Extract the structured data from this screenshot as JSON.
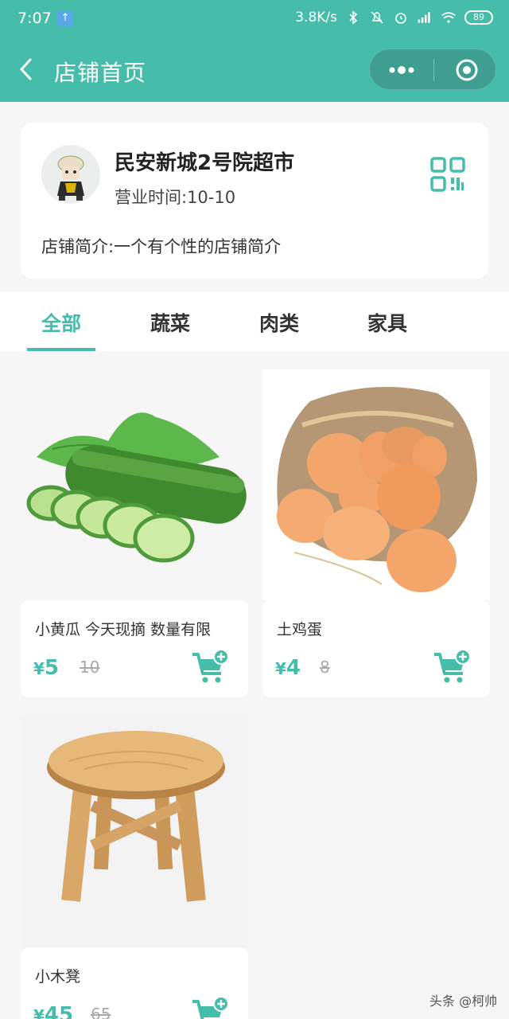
{
  "status_bar": {
    "time": "7:07",
    "speed": "3.8K/s",
    "battery": "89"
  },
  "nav": {
    "title": "店铺首页"
  },
  "store": {
    "name": "民安新城2号院超市",
    "hours": "营业时间:10-10",
    "intro": "店铺简介:一个有个性的店铺简介"
  },
  "tabs": [
    {
      "label": "全部",
      "active": true
    },
    {
      "label": "蔬菜",
      "active": false
    },
    {
      "label": "肉类",
      "active": false
    },
    {
      "label": "家具",
      "active": false
    }
  ],
  "products": [
    {
      "name": "小黄瓜 今天现摘 数量有限",
      "currency": "¥",
      "price": "5",
      "old_price": "10"
    },
    {
      "name": "土鸡蛋",
      "currency": "¥",
      "price": "4",
      "old_price": "8"
    },
    {
      "name": "小木凳",
      "currency": "¥",
      "price": "45",
      "old_price": "65"
    }
  ],
  "watermark": "头条 @柯帅",
  "colors": {
    "accent": "#46bdaa",
    "background": "#f6f6f6"
  }
}
